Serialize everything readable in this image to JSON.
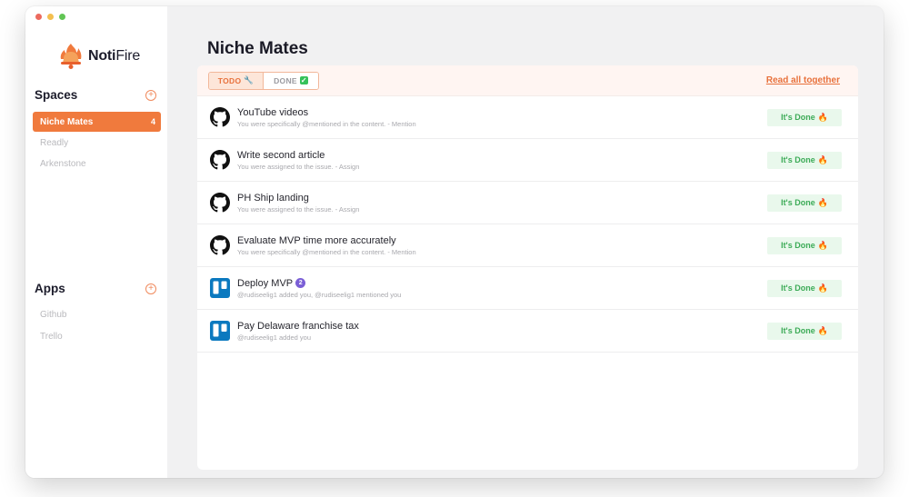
{
  "brand": {
    "name_bold": "Noti",
    "name_light": "Fire"
  },
  "sidebar": {
    "spaces_title": "Spaces",
    "spaces": [
      {
        "label": "Niche Mates",
        "count": "4",
        "active": true
      },
      {
        "label": "Readly"
      },
      {
        "label": "Arkenstone"
      }
    ],
    "apps_title": "Apps",
    "apps": [
      {
        "label": "Github"
      },
      {
        "label": "Trello"
      }
    ]
  },
  "main": {
    "title": "Niche Mates",
    "tabs": [
      {
        "label": "TODO",
        "icon": "wrench-icon",
        "glyph": "🔧"
      },
      {
        "label": "DONE",
        "icon": "check-icon",
        "glyph": "✓"
      }
    ],
    "read_all_label": "Read all together",
    "done_label": "It's Done",
    "done_icon": "🔥",
    "items": [
      {
        "source": "github",
        "title": "YouTube videos",
        "subtitle": "You were specifically @mentioned in the content. - Mention"
      },
      {
        "source": "github",
        "title": "Write second article",
        "subtitle": "You were assigned to the issue. - Assign"
      },
      {
        "source": "github",
        "title": "PH Ship landing",
        "subtitle": "You were assigned to the issue. - Assign"
      },
      {
        "source": "github",
        "title": "Evaluate MVP time more accurately",
        "subtitle": "You were specifically @mentioned in the content. - Mention"
      },
      {
        "source": "trello",
        "title": "Deploy MVP",
        "badge": "2",
        "subtitle": "@rudiseelig1 added you, @rudiseelig1 mentioned you"
      },
      {
        "source": "trello",
        "title": "Pay Delaware franchise tax",
        "subtitle": "@rudiseelig1 added you"
      }
    ]
  },
  "colors": {
    "accent": "#f07a3d",
    "done_bg": "#e9f8ec",
    "done_text": "#3cab57",
    "trello": "#0b79bf",
    "badge": "#7b5fd6"
  }
}
